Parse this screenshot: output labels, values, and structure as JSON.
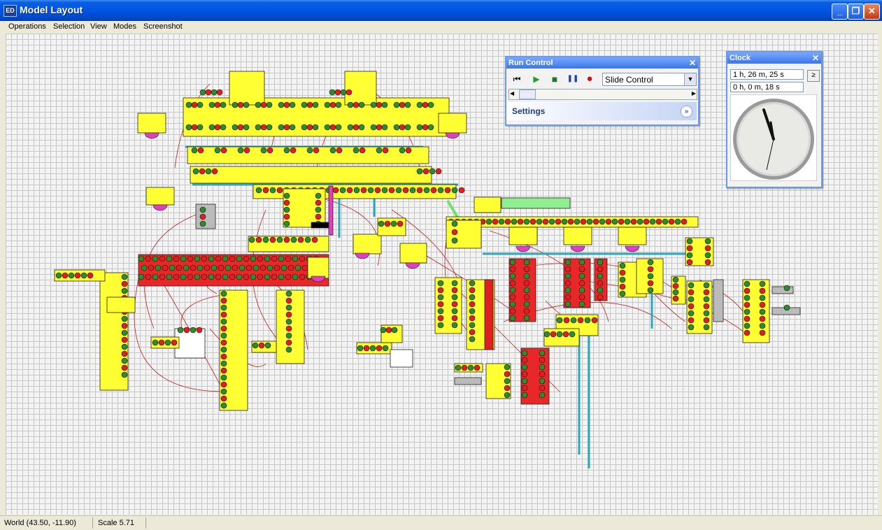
{
  "window": {
    "icon_label": "ED",
    "title": "Model Layout",
    "minimize": "_",
    "maximize": "❐",
    "close": "✕"
  },
  "menu": [
    "Operations",
    "Selection",
    "View",
    "Modes",
    "Screenshot"
  ],
  "status": {
    "world": "World (43.50, -11.90)",
    "scale": "Scale 5.71"
  },
  "run_control": {
    "title": "Run Control",
    "close": "✕",
    "mode": "Slide Control",
    "settings_label": "Settings",
    "settings_toggle": "»",
    "buttons": {
      "step": "⏮",
      "play": "▶",
      "stop": "■",
      "pause": "❚❚",
      "record": "●"
    },
    "scroll_left": "◀",
    "scroll_right": "▶"
  },
  "clock": {
    "title": "Clock",
    "close": "✕",
    "elapsed": "1 h, 26 m, 25 s",
    "sim_time": "0 h, 0 m, 18 s",
    "button": "≥"
  },
  "colors": {
    "block_fill": "#ffff33",
    "port_green": "#2e8b2e",
    "port_red": "#e02020",
    "connection": "#c02020",
    "conveyor": "#2aa8b8",
    "sink": "#e040c0"
  }
}
